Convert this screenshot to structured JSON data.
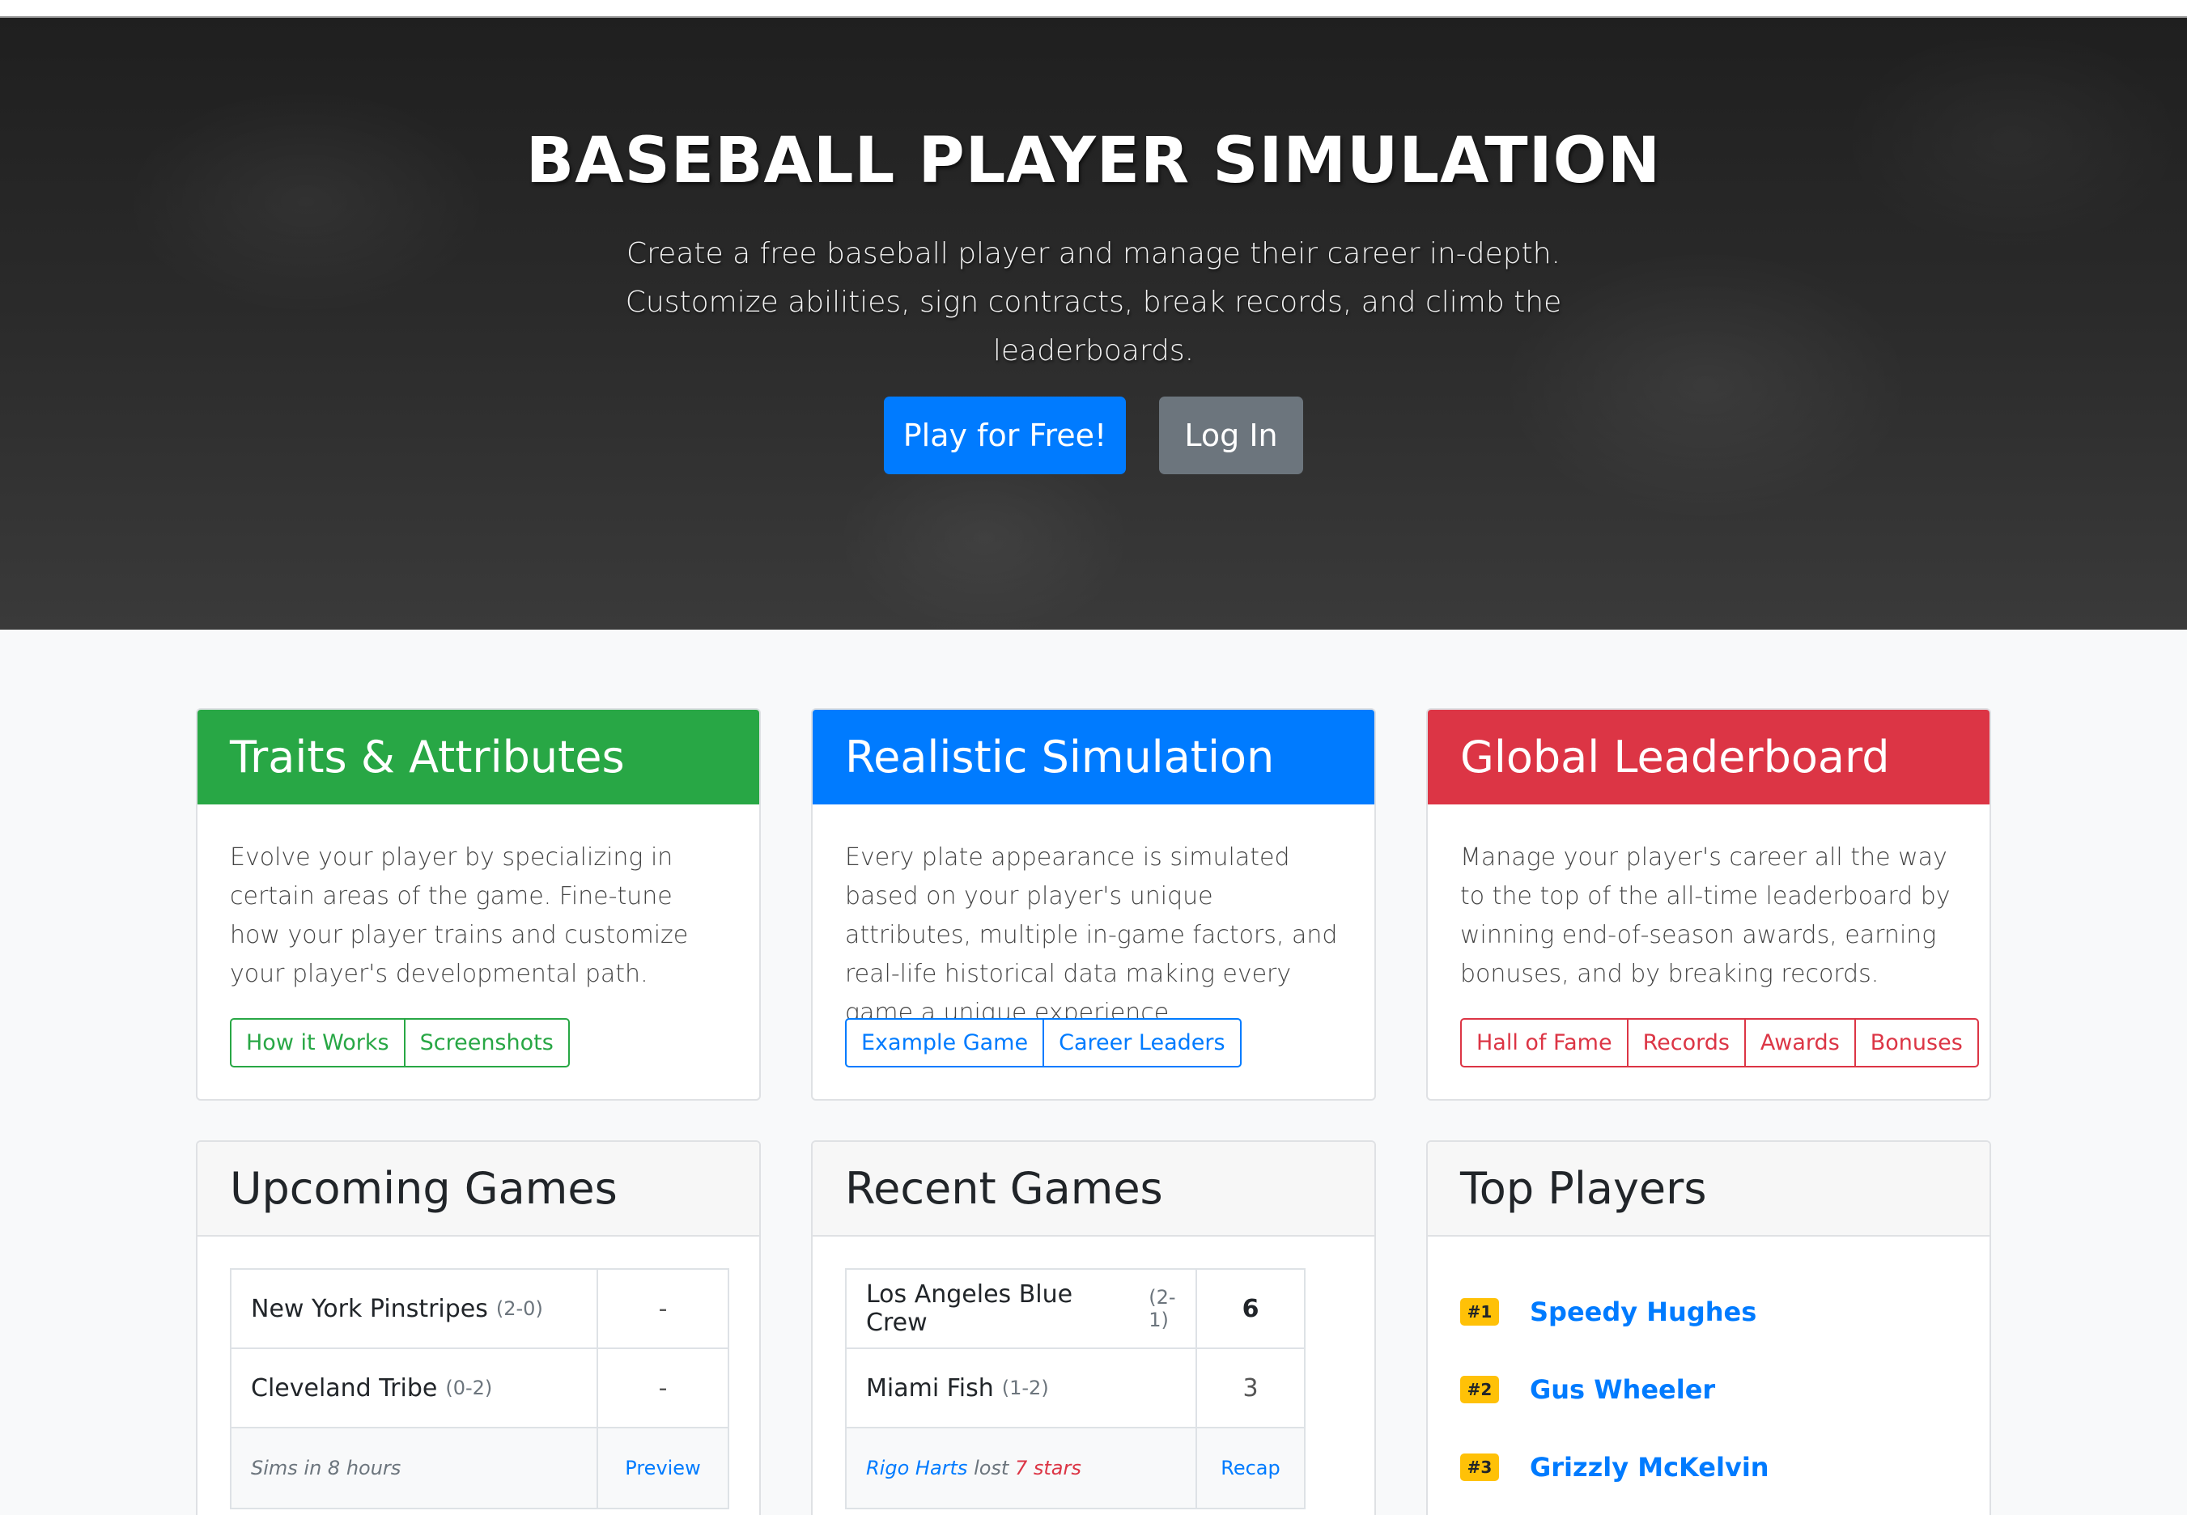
{
  "hero": {
    "title": "BASEBALL PLAYER SIMULATION",
    "subtitle_lines": [
      "Create a free baseball player and manage their career in-depth.",
      "Customize abilities, sign contracts, break records, and climb the",
      "leaderboards."
    ],
    "play_button": "Play for Free!",
    "login_button": "Log In"
  },
  "features": [
    {
      "title": "Traits & Attributes",
      "color": "#28a745",
      "text": "Evolve your player by specializing in certain areas of the game. Fine-tune how your player trains and customize your player's developmental path.",
      "buttons": [
        "How it Works",
        "Screenshots"
      ]
    },
    {
      "title": "Realistic Simulation",
      "color": "#007bff",
      "text": "Every plate appearance is simulated based on your player's unique attributes, multiple in-game factors, and real-life historical data making every game a unique experience.",
      "buttons": [
        "Example Game",
        "Career Leaders"
      ]
    },
    {
      "title": "Global Leaderboard",
      "color": "#dc3545",
      "text": "Manage your player's career all the way to the top of the all-time leaderboard by winning end-of-season awards, earning bonuses, and by breaking records.",
      "buttons": [
        "Hall of Fame",
        "Records",
        "Awards",
        "Bonuses"
      ]
    }
  ],
  "upcoming": {
    "title": "Upcoming Games",
    "rows": [
      {
        "team": "New York Pinstripes",
        "record": "(2-0)",
        "value": "-"
      },
      {
        "team": "Cleveland Tribe",
        "record": "(0-2)",
        "value": "-"
      }
    ],
    "footer_text": "Sims in 8 hours",
    "footer_link": "Preview"
  },
  "recent": {
    "title": "Recent Games",
    "rows": [
      {
        "team": "Los Angeles Blue Crew",
        "record": "(2-1)",
        "value": "6"
      },
      {
        "team": "Miami Fish",
        "record": "(1-2)",
        "value": "3"
      }
    ],
    "footer_player": "Rigo Harts",
    "footer_mid": "lost",
    "footer_stars": "7 stars",
    "footer_link": "Recap"
  },
  "top_players": {
    "title": "Top Players",
    "players": [
      {
        "rank": "#1",
        "name": "Speedy Hughes"
      },
      {
        "rank": "#2",
        "name": "Gus Wheeler"
      },
      {
        "rank": "#3",
        "name": "Grizzly McKelvin"
      }
    ]
  }
}
